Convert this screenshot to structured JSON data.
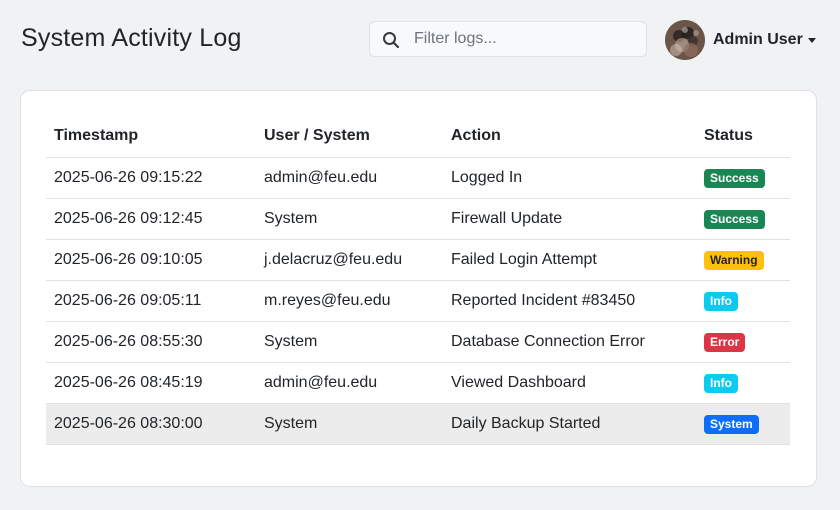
{
  "header": {
    "title": "System Activity Log",
    "search_placeholder": "Filter logs...",
    "user_name": "Admin User"
  },
  "table": {
    "columns": [
      "Timestamp",
      "User / System",
      "Action",
      "Status"
    ],
    "rows": [
      {
        "timestamp": "2025-06-26 09:15:22",
        "user": "admin@feu.edu",
        "action": "Logged In",
        "status": "Success",
        "status_color": "#198754",
        "status_text_color": "#ffffff"
      },
      {
        "timestamp": "2025-06-26 09:12:45",
        "user": "System",
        "action": "Firewall Update",
        "status": "Success",
        "status_color": "#198754",
        "status_text_color": "#ffffff"
      },
      {
        "timestamp": "2025-06-26 09:10:05",
        "user": "j.delacruz@feu.edu",
        "action": "Failed Login Attempt",
        "status": "Warning",
        "status_color": "#ffc107",
        "status_text_color": "#212529"
      },
      {
        "timestamp": "2025-06-26 09:05:11",
        "user": "m.reyes@feu.edu",
        "action": "Reported Incident #83450",
        "status": "Info",
        "status_color": "#0dcaf0",
        "status_text_color": "#ffffff"
      },
      {
        "timestamp": "2025-06-26 08:55:30",
        "user": "System",
        "action": "Database Connection Error",
        "status": "Error",
        "status_color": "#dc3545",
        "status_text_color": "#ffffff"
      },
      {
        "timestamp": "2025-06-26 08:45:19",
        "user": "admin@feu.edu",
        "action": "Viewed Dashboard",
        "status": "Info",
        "status_color": "#0dcaf0",
        "status_text_color": "#ffffff"
      },
      {
        "timestamp": "2025-06-26 08:30:00",
        "user": "System",
        "action": "Daily Backup Started",
        "status": "System",
        "status_color": "#0d6efd",
        "status_text_color": "#ffffff",
        "highlighted": true
      }
    ]
  },
  "icons": {
    "search": "search-icon",
    "avatar": "avatar-image",
    "caret": "chevron-down-icon"
  }
}
